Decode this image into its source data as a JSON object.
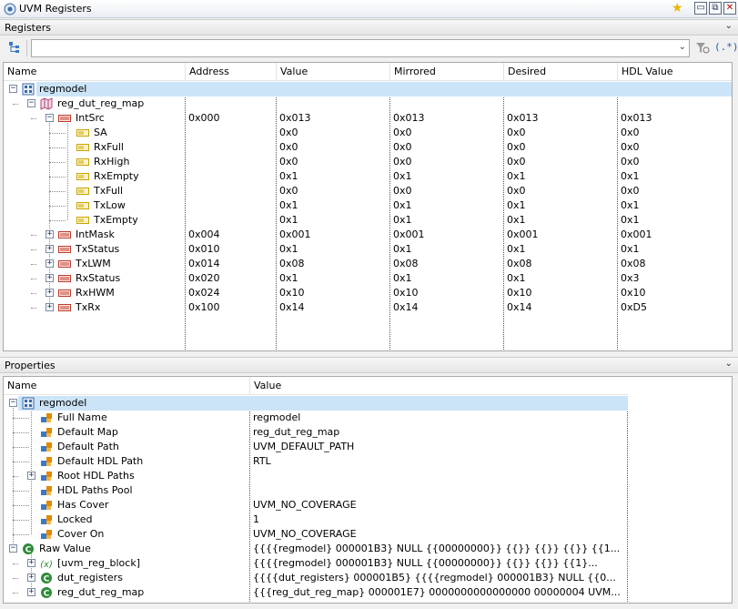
{
  "window": {
    "title": "UVM Registers"
  },
  "registers_panel": {
    "header": "Registers",
    "filter": {
      "value": "",
      "placeholder": ""
    },
    "regex_label": "(.*)",
    "columns": [
      "Name",
      "Address",
      "Value",
      "Mirrored",
      "Desired",
      "HDL Value"
    ],
    "rows": [
      {
        "name": "regmodel",
        "address": "",
        "value": "",
        "mirrored": "",
        "desired": "",
        "hdl": "",
        "icon": "block-icon",
        "expander": "minus"
      },
      {
        "name": "reg_dut_reg_map",
        "address": "",
        "value": "",
        "mirrored": "",
        "desired": "",
        "hdl": "",
        "icon": "map-icon",
        "expander": "minus"
      },
      {
        "name": "IntSrc",
        "address": "0x000",
        "value": "0x013",
        "mirrored": "0x013",
        "desired": "0x013",
        "hdl": "0x013",
        "icon": "register-icon",
        "expander": "minus"
      },
      {
        "name": "SA",
        "address": "",
        "value": "0x0",
        "mirrored": "0x0",
        "desired": "0x0",
        "hdl": "0x0",
        "icon": "field-icon",
        "expander": ""
      },
      {
        "name": "RxFull",
        "address": "",
        "value": "0x0",
        "mirrored": "0x0",
        "desired": "0x0",
        "hdl": "0x0",
        "icon": "field-icon",
        "expander": ""
      },
      {
        "name": "RxHigh",
        "address": "",
        "value": "0x0",
        "mirrored": "0x0",
        "desired": "0x0",
        "hdl": "0x0",
        "icon": "field-icon",
        "expander": ""
      },
      {
        "name": "RxEmpty",
        "address": "",
        "value": "0x1",
        "mirrored": "0x1",
        "desired": "0x1",
        "hdl": "0x1",
        "icon": "field-icon",
        "expander": ""
      },
      {
        "name": "TxFull",
        "address": "",
        "value": "0x0",
        "mirrored": "0x0",
        "desired": "0x0",
        "hdl": "0x0",
        "icon": "field-icon",
        "expander": ""
      },
      {
        "name": "TxLow",
        "address": "",
        "value": "0x1",
        "mirrored": "0x1",
        "desired": "0x1",
        "hdl": "0x1",
        "icon": "field-icon",
        "expander": ""
      },
      {
        "name": "TxEmpty",
        "address": "",
        "value": "0x1",
        "mirrored": "0x1",
        "desired": "0x1",
        "hdl": "0x1",
        "icon": "field-icon",
        "expander": ""
      },
      {
        "name": "IntMask",
        "address": "0x004",
        "value": "0x001",
        "mirrored": "0x001",
        "desired": "0x001",
        "hdl": "0x001",
        "icon": "register-icon",
        "expander": "plus"
      },
      {
        "name": "TxStatus",
        "address": "0x010",
        "value": "0x1",
        "mirrored": "0x1",
        "desired": "0x1",
        "hdl": "0x1",
        "icon": "register-icon",
        "expander": "plus"
      },
      {
        "name": "TxLWM",
        "address": "0x014",
        "value": "0x08",
        "mirrored": "0x08",
        "desired": "0x08",
        "hdl": "0x08",
        "icon": "register-icon",
        "expander": "plus"
      },
      {
        "name": "RxStatus",
        "address": "0x020",
        "value": "0x1",
        "mirrored": "0x1",
        "desired": "0x1",
        "hdl": "0x3",
        "icon": "register-icon",
        "expander": "plus"
      },
      {
        "name": "RxHWM",
        "address": "0x024",
        "value": "0x10",
        "mirrored": "0x10",
        "desired": "0x10",
        "hdl": "0x10",
        "icon": "register-icon",
        "expander": "plus"
      },
      {
        "name": "TxRx",
        "address": "0x100",
        "value": "0x14",
        "mirrored": "0x14",
        "desired": "0x14",
        "hdl": "0xD5",
        "icon": "register-icon",
        "expander": "plus"
      }
    ]
  },
  "properties_panel": {
    "header": "Properties",
    "columns": [
      "Name",
      "Value"
    ],
    "rows": [
      {
        "name": "regmodel",
        "value": "",
        "icon": "block-icon",
        "expander": "minus"
      },
      {
        "name": "Full Name",
        "value": "regmodel",
        "icon": "property-icon",
        "expander": ""
      },
      {
        "name": "Default Map",
        "value": "reg_dut_reg_map",
        "icon": "property-icon",
        "expander": ""
      },
      {
        "name": "Default Path",
        "value": "UVM_DEFAULT_PATH",
        "icon": "property-icon",
        "expander": ""
      },
      {
        "name": "Default HDL Path",
        "value": "RTL",
        "icon": "property-icon",
        "expander": ""
      },
      {
        "name": "Root HDL Paths",
        "value": "",
        "icon": "property-icon",
        "expander": "plus"
      },
      {
        "name": "HDL Paths Pool",
        "value": "",
        "icon": "property-icon",
        "expander": ""
      },
      {
        "name": "Has Cover",
        "value": "UVM_NO_COVERAGE",
        "icon": "property-icon",
        "expander": ""
      },
      {
        "name": "Locked",
        "value": "1",
        "icon": "property-icon",
        "expander": ""
      },
      {
        "name": "Cover On",
        "value": "UVM_NO_COVERAGE",
        "icon": "property-icon",
        "expander": ""
      },
      {
        "name": "Raw Value",
        "value": "{{{{regmodel} 000001B3} NULL {{00000000}} {{}} {{}} {{}} {{1...",
        "icon": "class-icon",
        "expander": "minus"
      },
      {
        "name": "[uvm_reg_block]",
        "value": "{{{{regmodel} 000001B3} NULL {{00000000}} {{}} {{}} {{1}...",
        "icon": "variable-icon",
        "expander": "plus"
      },
      {
        "name": "dut_registers",
        "value": "{{{{dut_registers} 000001B5} {{{{regmodel} 000001B3} NULL {{0...",
        "icon": "class-icon",
        "expander": "plus"
      },
      {
        "name": "reg_dut_reg_map",
        "value": "{{{reg_dut_reg_map} 000001E7} 0000000000000000 00000004 UVM...",
        "icon": "class-icon",
        "expander": "plus"
      }
    ]
  },
  "colors": {
    "selection": "#cce4f7",
    "register": "#c0392b",
    "field": "#c8a400",
    "property": "#e08a00",
    "class": "#2e8b3a"
  }
}
